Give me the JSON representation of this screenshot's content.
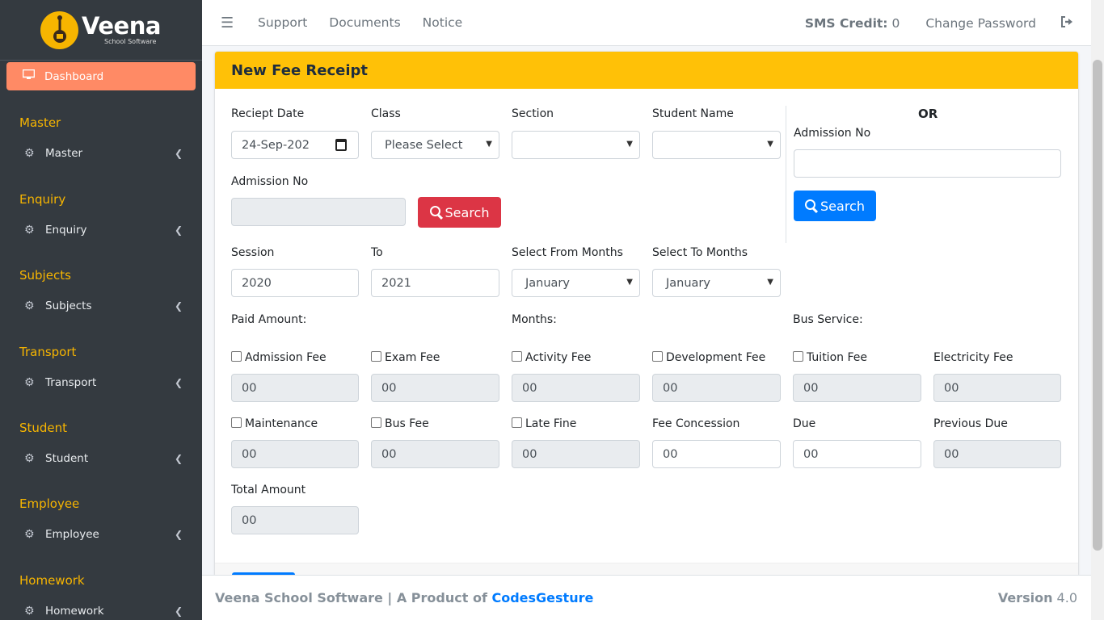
{
  "brand": {
    "name": "Veena",
    "tagline": "School Software"
  },
  "sidebar": {
    "active": {
      "label": "Dashboard"
    },
    "sections": [
      {
        "header": "Master",
        "item": "Master"
      },
      {
        "header": "Enquiry",
        "item": "Enquiry"
      },
      {
        "header": "Subjects",
        "item": "Subjects"
      },
      {
        "header": "Transport",
        "item": "Transport"
      },
      {
        "header": "Student",
        "item": "Student"
      },
      {
        "header": "Employee",
        "item": "Employee"
      },
      {
        "header": "Homework",
        "item": "Homework"
      }
    ]
  },
  "topbar": {
    "links": [
      "Support",
      "Documents",
      "Notice"
    ],
    "sms_label": "SMS Credit:",
    "sms_value": "0",
    "change_password": "Change Password"
  },
  "form": {
    "title": "New Fee Receipt",
    "receipt_date": {
      "label": "Reciept Date",
      "value": "24-Sep-202"
    },
    "class": {
      "label": "Class",
      "value": "Please Select"
    },
    "section": {
      "label": "Section",
      "value": ""
    },
    "student_name": {
      "label": "Student Name",
      "value": ""
    },
    "admission_left": {
      "label": "Admission No",
      "value": ""
    },
    "search_label": "Search",
    "or_label": "OR",
    "admission_right": {
      "label": "Admission No",
      "value": ""
    },
    "session": {
      "label": "Session",
      "value": "2020"
    },
    "to": {
      "label": "To",
      "value": "2021"
    },
    "from_months": {
      "label": "Select From Months",
      "value": "January"
    },
    "to_months": {
      "label": "Select To Months",
      "value": "January"
    },
    "paid_amount_label": "Paid Amount:",
    "months_label": "Months:",
    "bus_service_label": "Bus Service:",
    "fees_row1": [
      {
        "label": "Admission Fee",
        "value": "00",
        "checkbox": true
      },
      {
        "label": "Exam Fee",
        "value": "00",
        "checkbox": true
      },
      {
        "label": "Activity Fee",
        "value": "00",
        "checkbox": true
      },
      {
        "label": "Development Fee",
        "value": "00",
        "checkbox": true
      },
      {
        "label": "Tuition Fee",
        "value": "00",
        "checkbox": true
      },
      {
        "label": "Electricity Fee",
        "value": "00",
        "checkbox": false
      }
    ],
    "fees_row2": [
      {
        "label": "Maintenance",
        "value": "00",
        "checkbox": true
      },
      {
        "label": "Bus Fee",
        "value": "00",
        "checkbox": true
      },
      {
        "label": "Late Fine",
        "value": "00",
        "checkbox": true
      },
      {
        "label": "Fee Concession",
        "value": "00",
        "checkbox": false
      },
      {
        "label": "Due",
        "value": "00",
        "checkbox": false
      },
      {
        "label": "Previous Due",
        "value": "00",
        "checkbox": false
      }
    ],
    "total": {
      "label": "Total Amount",
      "value": "00"
    }
  },
  "footer": {
    "text": "Veena School Software | A Product of",
    "company": "CodesGesture",
    "version_label": "Version",
    "version_value": "4.0"
  }
}
